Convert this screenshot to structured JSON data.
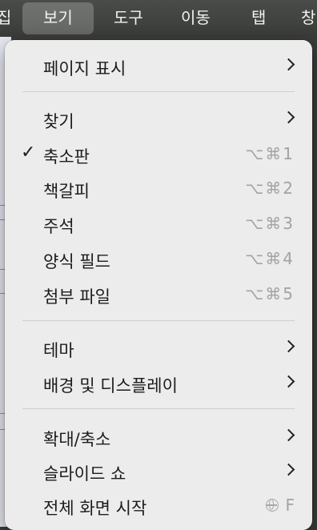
{
  "menubar": {
    "items": [
      "집",
      "보기",
      "도구",
      "이동",
      "탭",
      "창"
    ],
    "active": "보기"
  },
  "menu": {
    "page_display": "페이지 표시",
    "find": "찾기",
    "thumbnails": "축소판",
    "thumbnails_shortcut": "⌥⌘1",
    "bookmarks": "책갈피",
    "bookmarks_shortcut": "⌥⌘2",
    "annotations": "주석",
    "annotations_shortcut": "⌥⌘3",
    "form_fields": "양식 필드",
    "form_fields_shortcut": "⌥⌘4",
    "attachments": "첨부 파일",
    "attachments_shortcut": "⌥⌘5",
    "theme": "테마",
    "background_display": "배경 및 디스플레이",
    "zoom": "확대/축소",
    "slideshow": "슬라이드 쇼",
    "fullscreen": "전체 화면 시작",
    "fullscreen_key": "F",
    "checked_item": "축소판"
  }
}
